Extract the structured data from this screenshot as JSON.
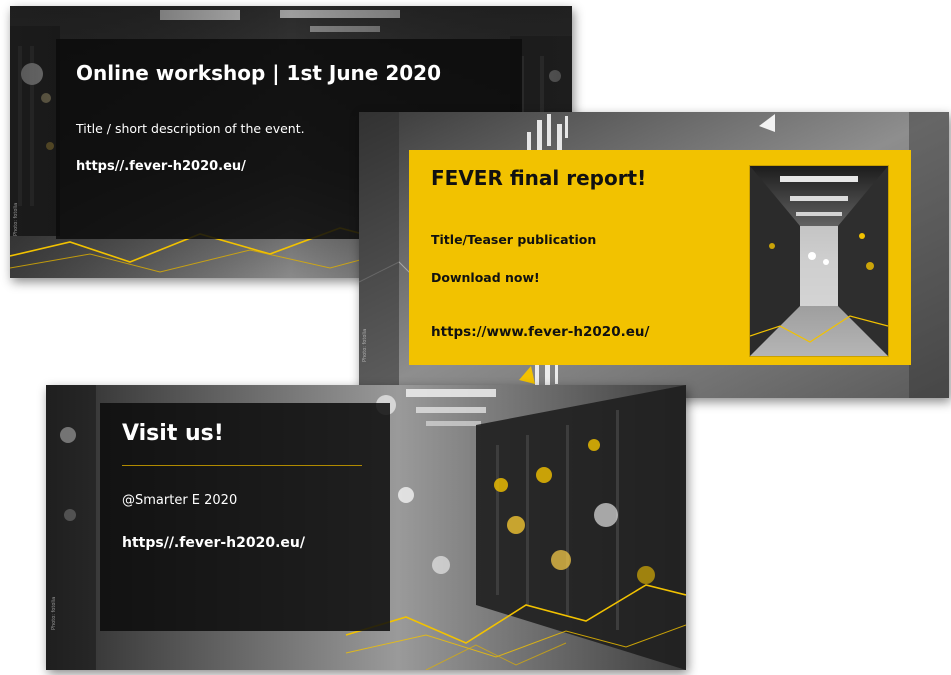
{
  "banner_workshop": {
    "title": "Online workshop | 1st June 2020",
    "description": "Title / short description of the event.",
    "link": "https//.fever-h2020.eu/"
  },
  "banner_report": {
    "title": "FEVER final report!",
    "teaser": "Title/Teaser publication",
    "cta": "Download now!",
    "link": "https://www.fever-h2020.eu/"
  },
  "banner_visit": {
    "title": "Visit us!",
    "event": "@Smarter E 2020",
    "link": "https//.fever-h2020.eu/"
  },
  "colors": {
    "accent_yellow": "#f2c200",
    "panel_dark": "#0c0c0c",
    "text_light": "#ffffff"
  }
}
